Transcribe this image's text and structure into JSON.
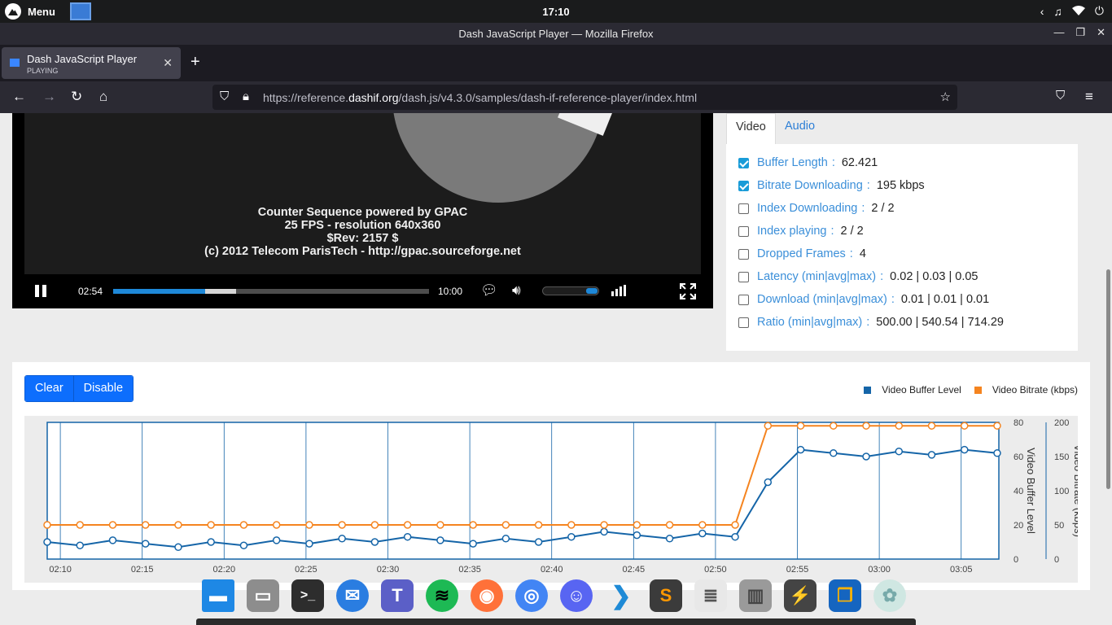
{
  "system": {
    "menu_label": "Menu",
    "clock": "17:10"
  },
  "window": {
    "title": "Dash JavaScript Player — Mozilla Firefox"
  },
  "tab": {
    "title": "Dash JavaScript Player",
    "status": "PLAYING"
  },
  "urlbar": {
    "url_prefix": "https://reference.",
    "url_domain": "dashif.org",
    "url_path": "/dash.js/v4.3.0/samples/dash-if-reference-player/index.html"
  },
  "video": {
    "caption_lines": [
      "Counter Sequence powered by GPAC",
      "25 FPS - resolution 640x360",
      "$Rev: 2157 $",
      "(c) 2012 Telecom ParisTech - http://gpac.sourceforge.net"
    ],
    "current_time": "02:54",
    "duration": "10:00",
    "played_fraction": 0.29,
    "buffered_fraction": 0.39,
    "volume_fraction": 1.0
  },
  "stats": {
    "tabs": [
      "Video",
      "Audio"
    ],
    "active_tab": "Video",
    "items": [
      {
        "label": "Buffer Length",
        "value": "62.421",
        "checked": true
      },
      {
        "label": "Bitrate Downloading",
        "value": "195 kbps",
        "checked": true
      },
      {
        "label": "Index Downloading",
        "value": "2 / 2",
        "checked": false
      },
      {
        "label": "Index playing",
        "value": "2 / 2",
        "checked": false
      },
      {
        "label": "Dropped Frames",
        "value": "4",
        "checked": false
      },
      {
        "label": "Latency (min|avg|max)",
        "value": "0.02 | 0.03 | 0.05",
        "checked": false
      },
      {
        "label": "Download (min|avg|max)",
        "value": "0.01 | 0.01 | 0.01",
        "checked": false
      },
      {
        "label": "Ratio (min|avg|max)",
        "value": "500.00 | 540.54 | 714.29",
        "checked": false
      }
    ]
  },
  "chart_controls": {
    "clear_label": "Clear",
    "disable_label": "Disable"
  },
  "chart_data": {
    "type": "line",
    "x_tick_labels": [
      "02:10",
      "02:15",
      "02:20",
      "02:25",
      "02:30",
      "02:35",
      "02:40",
      "02:45",
      "02:50",
      "02:55",
      "03:00",
      "03:05"
    ],
    "x_tick_seconds": [
      130,
      135,
      140,
      145,
      150,
      155,
      160,
      165,
      170,
      175,
      180,
      185
    ],
    "x_range_seconds": [
      129.2,
      187.3
    ],
    "grid": true,
    "legend_placement": "top-right",
    "series": [
      {
        "name": "Video Buffer Level",
        "axis": "left",
        "color": "#1565a8",
        "x_seconds": [
          129.2,
          131.2,
          133.2,
          135.2,
          137.2,
          139.2,
          141.2,
          143.2,
          145.2,
          147.2,
          149.2,
          151.2,
          153.2,
          155.2,
          157.2,
          159.2,
          161.2,
          163.2,
          165.2,
          167.2,
          169.2,
          171.2,
          173.2,
          175.2,
          177.2,
          179.2,
          181.2,
          183.2,
          185.2,
          187.2
        ],
        "values": [
          10,
          8,
          11,
          9,
          7,
          10,
          8,
          11,
          9,
          12,
          10,
          13,
          11,
          9,
          12,
          10,
          13,
          16,
          14,
          12,
          15,
          13,
          45,
          64,
          62,
          60,
          63,
          61,
          64,
          62
        ]
      },
      {
        "name": "Video Bitrate (kbps)",
        "axis": "right",
        "color": "#f5841f",
        "x_seconds": [
          129.2,
          131.2,
          133.2,
          135.2,
          137.2,
          139.2,
          141.2,
          143.2,
          145.2,
          147.2,
          149.2,
          151.2,
          153.2,
          155.2,
          157.2,
          159.2,
          161.2,
          163.2,
          165.2,
          167.2,
          169.2,
          171.2,
          173.2,
          175.2,
          177.2,
          179.2,
          181.2,
          183.2,
          185.2,
          187.2
        ],
        "values": [
          50,
          50,
          50,
          50,
          50,
          50,
          50,
          50,
          50,
          50,
          50,
          50,
          50,
          50,
          50,
          50,
          50,
          50,
          50,
          50,
          50,
          50,
          195,
          195,
          195,
          195,
          195,
          195,
          195,
          195
        ]
      }
    ],
    "y_left": {
      "label": "Video Buffer Level",
      "range": [
        0,
        80
      ],
      "ticks": [
        0,
        20,
        40,
        60,
        80
      ]
    },
    "y_right": {
      "label": "Video Bitrate (kbps)",
      "range": [
        0,
        200
      ],
      "ticks": [
        0,
        50,
        100,
        150,
        200
      ]
    },
    "colors": {
      "buffer": "#1565a8",
      "bitrate": "#f5841f"
    }
  },
  "dock": {
    "apps": [
      "desktop-icon",
      "files-icon",
      "terminal-icon",
      "thunderbird-icon",
      "teams-icon",
      "spotify-icon",
      "firefox-icon",
      "chromium-icon",
      "discord-icon",
      "vscode-icon",
      "sublime-icon",
      "text-editor-icon",
      "trash-icon",
      "wine-icon",
      "virtualbox-icon",
      "settings-icon"
    ]
  }
}
